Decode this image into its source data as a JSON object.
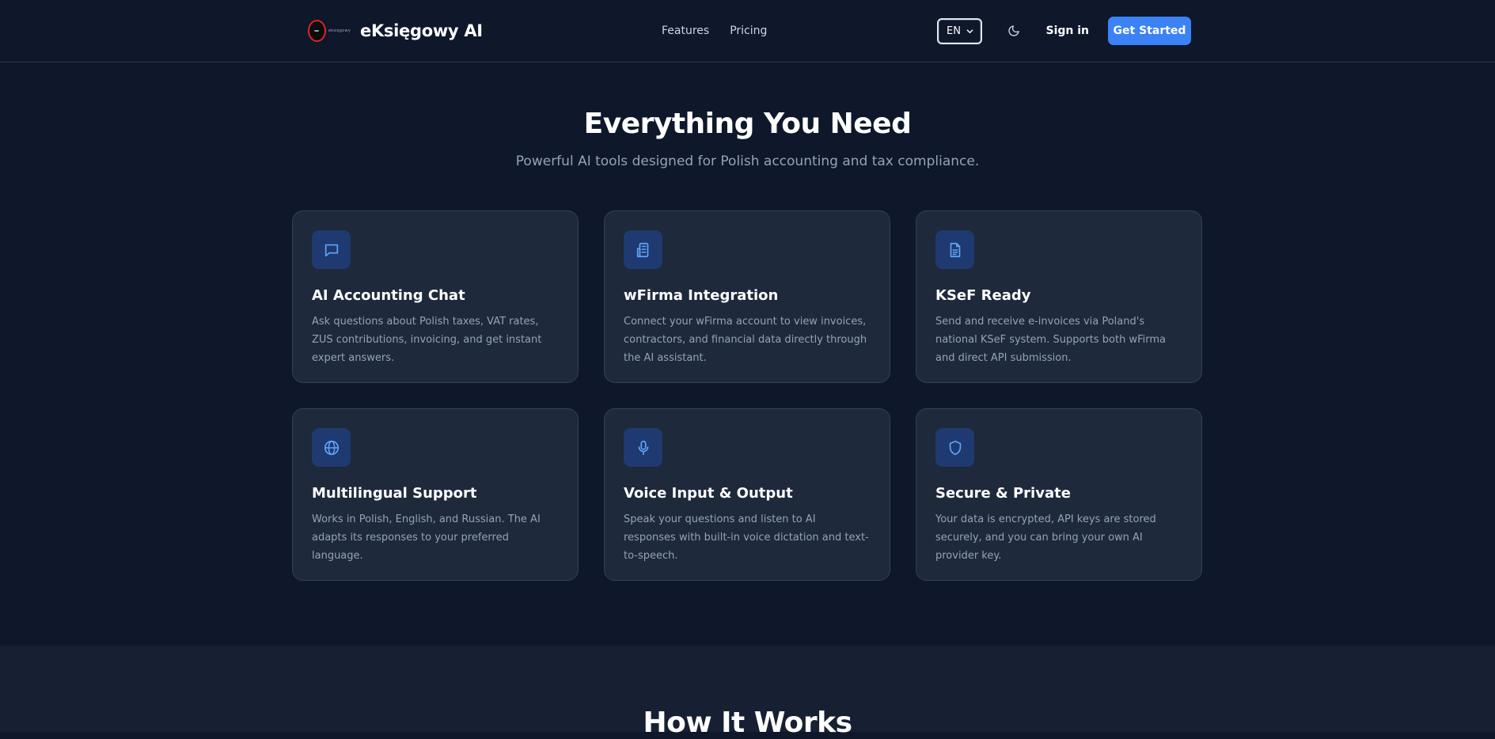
{
  "header": {
    "brand_name": "eKsięgowy AI",
    "logo_caption": "eksięgowy",
    "nav": [
      "Features",
      "Pricing"
    ],
    "language": "EN",
    "signin_label": "Sign in",
    "cta_label": "Get Started"
  },
  "features": {
    "title": "Everything You Need",
    "subtitle": "Powerful AI tools designed for Polish accounting and tax compliance.",
    "cards": [
      {
        "icon": "chat-icon",
        "title": "AI Accounting Chat",
        "description": "Ask questions about Polish taxes, VAT rates, ZUS contributions, invoicing, and get instant expert answers."
      },
      {
        "icon": "building-icon",
        "title": "wFirma Integration",
        "description": "Connect your wFirma account to view invoices, contractors, and financial data directly through the AI assistant."
      },
      {
        "icon": "document-icon",
        "title": "KSeF Ready",
        "description": "Send and receive e-invoices via Poland's national KSeF system. Supports both wFirma and direct API submission."
      },
      {
        "icon": "globe-icon",
        "title": "Multilingual Support",
        "description": "Works in Polish, English, and Russian. The AI adapts its responses to your preferred language."
      },
      {
        "icon": "microphone-icon",
        "title": "Voice Input & Output",
        "description": "Speak your questions and listen to AI responses with built-in voice dictation and text-to-speech."
      },
      {
        "icon": "shield-icon",
        "title": "Secure & Private",
        "description": "Your data is encrypted, API keys are stored securely, and you can bring your own AI provider key."
      }
    ]
  },
  "how_it_works": {
    "title": "How It Works"
  },
  "colors": {
    "background": "#0f172a",
    "card": "#1e293b",
    "accent": "#3b82f6",
    "icon_bg": "#1e3a70"
  }
}
